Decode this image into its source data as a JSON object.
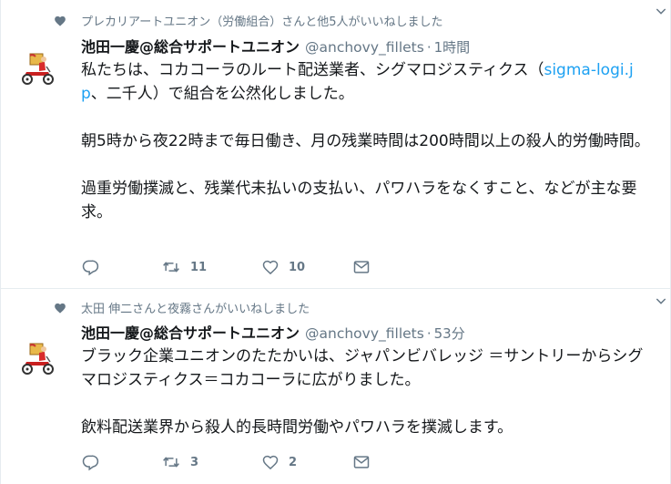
{
  "tweets": [
    {
      "context": "プレカリアートユニオン（労働組合）さんと他5人がいいねしました",
      "fullname": "池田一慶@総合サポートユニオン",
      "handle": "@anchovy_fillets",
      "time": "1時間",
      "text_part1": "私たちは、コカコーラのルート配送業者、シグマロジスティクス（",
      "link": "sigma-logi.jp",
      "text_part2": "、二千人）で組合を公然化しました。\n\n朝5時から夜22時まで毎日働き、月の残業時間は200時間以上の殺人的労働時間。\n\n過重労働撲滅と、残業代未払いの支払い、パワハラをなくすこと、などが主な要求。",
      "reply_count": "",
      "retweet_count": "11",
      "like_count": "10"
    },
    {
      "context": "太田 伸二さんと夜霧さんがいいねしました",
      "fullname": "池田一慶@総合サポートユニオン",
      "handle": "@anchovy_fillets",
      "time": "53分",
      "text": "ブラック企業ユニオンのたたかいは、ジャパンビバレッジ ＝サントリーからシグマロジスティクス＝コカコーラに広がりました。\n\n飲料配送業界から殺人的長時間労働やパワハラを撲滅します。",
      "reply_count": "",
      "retweet_count": "3",
      "like_count": "2"
    }
  ],
  "separator_dot": "·",
  "colors": {
    "accent": "#1da1f2",
    "secondary": "#657786",
    "text": "#14171a",
    "border": "#e6ecf0"
  },
  "icons": [
    "heart-icon",
    "avatar-rider-icon",
    "chevron-down-icon",
    "reply-icon",
    "retweet-icon",
    "like-icon",
    "direct-message-icon"
  ]
}
